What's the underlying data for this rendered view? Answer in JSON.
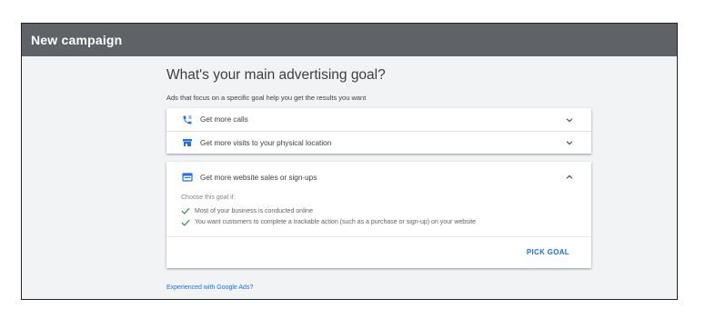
{
  "header": {
    "title": "New campaign"
  },
  "main": {
    "heading": "What's your main advertising goal?",
    "subheading": "Ads that focus on a specific goal help you get the results you want",
    "goals_collapsed": [
      {
        "label": "Get more calls",
        "icon": "phone-icon"
      },
      {
        "label": "Get more visits to your physical location",
        "icon": "storefront-icon"
      }
    ],
    "goal_expanded": {
      "label": "Get more website sales or sign-ups",
      "icon": "browser-window-icon",
      "choose_text": "Choose this goal if:",
      "criteria": [
        "Most of your business is conducted online",
        "You want customers to complete a trackable action (such as a purchase or sign-up) on your website"
      ],
      "action_label": "PICK GOAL"
    },
    "footer_link": "Experienced with Google Ads?"
  },
  "colors": {
    "header_bg": "#5f6368",
    "accent": "#1a73e8",
    "check": "#1e8e3e",
    "page_bg": "#f1f3f4"
  }
}
